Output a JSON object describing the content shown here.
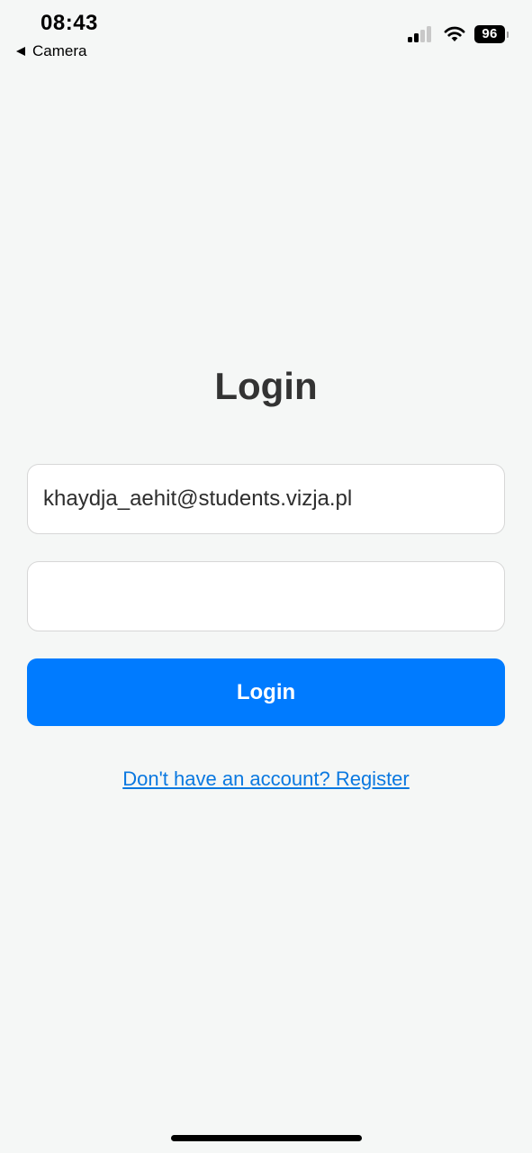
{
  "status_bar": {
    "time": "08:43",
    "back_app": "Camera",
    "battery": "96",
    "icons": [
      "signal-icon",
      "wifi-icon",
      "battery-icon"
    ]
  },
  "login": {
    "title": "Login",
    "email_value": "khaydja_aehit@students.vizja.pl",
    "password_value": "",
    "login_button_label": "Login",
    "register_link": "Don't have an account? Register"
  },
  "colors": {
    "background": "#f5f7f6",
    "primary": "#007bff",
    "link": "#0a78e0",
    "title": "#333333"
  }
}
